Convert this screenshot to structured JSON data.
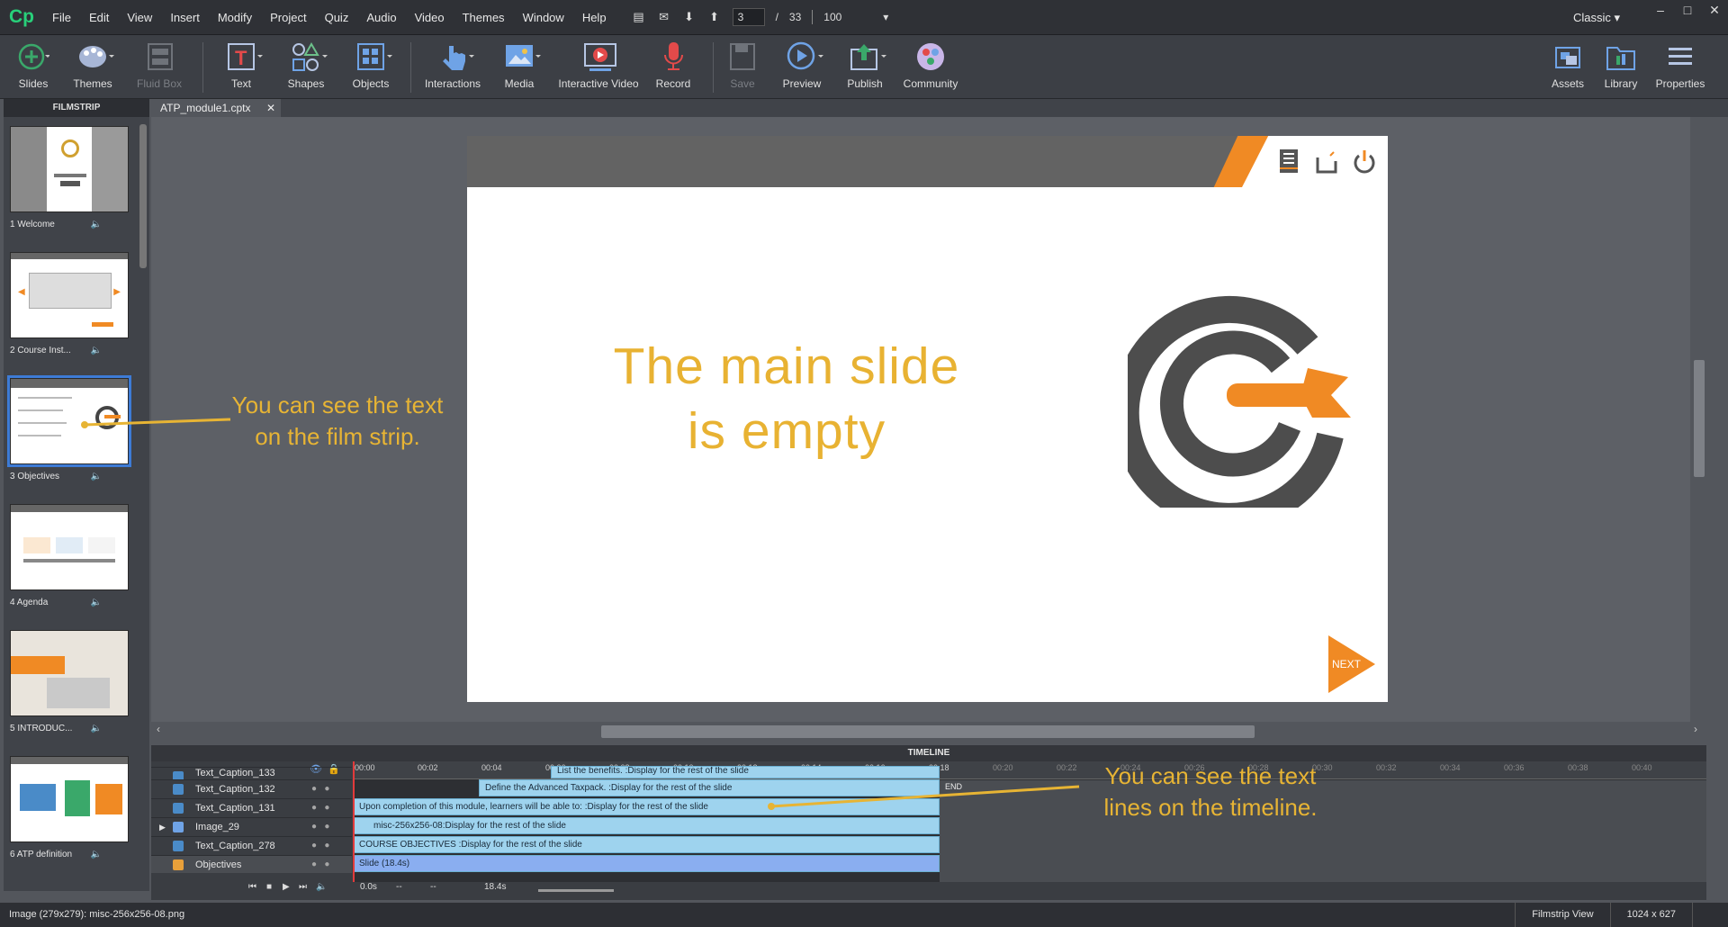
{
  "app": {
    "logo": "Cp",
    "workspace": "Classic"
  },
  "menu": [
    "File",
    "Edit",
    "View",
    "Insert",
    "Modify",
    "Project",
    "Quiz",
    "Audio",
    "Video",
    "Themes",
    "Window",
    "Help"
  ],
  "nav": {
    "current_slide": "3",
    "slash": "/",
    "total_slides": "33",
    "zoom": "100"
  },
  "toolbar": {
    "slides": "Slides",
    "themes": "Themes",
    "fluid_box": "Fluid Box",
    "text": "Text",
    "shapes": "Shapes",
    "objects": "Objects",
    "interactions": "Interactions",
    "media": "Media",
    "interactive_video": "Interactive Video",
    "record": "Record",
    "save": "Save",
    "preview": "Preview",
    "publish": "Publish",
    "community": "Community",
    "assets": "Assets",
    "library": "Library",
    "properties": "Properties"
  },
  "filmstrip": {
    "title": "FILMSTRIP",
    "slides": [
      {
        "label": "1 Welcome"
      },
      {
        "label": "2 Course Inst..."
      },
      {
        "label": "3 Objectives"
      },
      {
        "label": "4 Agenda"
      },
      {
        "label": "5 INTRODUC..."
      },
      {
        "label": "6 ATP definition"
      }
    ]
  },
  "document": {
    "tab": "ATP_module1.cptx"
  },
  "slide": {
    "main_text_line1": "The main slide",
    "main_text_line2": "is empty",
    "next": "NEXT"
  },
  "annotations": {
    "filmstrip_line1": "You can see the text",
    "filmstrip_line2": "on the film strip.",
    "timeline_line1": "You can see the text",
    "timeline_line2": "lines on the timeline."
  },
  "timeline": {
    "title": "TIMELINE",
    "ticks": [
      "00:00",
      "00:02",
      "00:04",
      "00:06",
      "00:08",
      "00:10",
      "00:12",
      "00:14",
      "00:16",
      "00:18",
      "00:20",
      "00:22",
      "00:24",
      "00:26",
      "00:28",
      "00:30",
      "00:32",
      "00:34",
      "00:36",
      "00:38",
      "00:40"
    ],
    "end_label": "END",
    "rows": [
      {
        "name": "Text_Caption_133",
        "bar": "List the benefits. :Display for the rest of the slide"
      },
      {
        "name": "Text_Caption_132",
        "bar": "Define the Advanced Taxpack. :Display for the rest of the slide"
      },
      {
        "name": "Text_Caption_131",
        "bar": "Upon completion of this module, learners will be able to: :Display for the rest of the slide"
      },
      {
        "name": "Image_29",
        "bar": "misc-256x256-08:Display for the rest of the slide"
      },
      {
        "name": "Text_Caption_278",
        "bar": "COURSE OBJECTIVES :Display for the rest of the slide"
      },
      {
        "name": "Objectives",
        "bar": "Slide (18.4s)"
      }
    ],
    "controls": {
      "start_time": "0.0s",
      "in": "--",
      "out": "--",
      "duration": "18.4s"
    }
  },
  "status": {
    "left": "Image (279x279): misc-256x256-08.png",
    "view": "Filmstrip View",
    "size": "1024 x 627"
  },
  "colors": {
    "accent_orange": "#f08a24",
    "caption_yellow": "#e8b232",
    "timeline_bar": "#9ed3ee"
  }
}
